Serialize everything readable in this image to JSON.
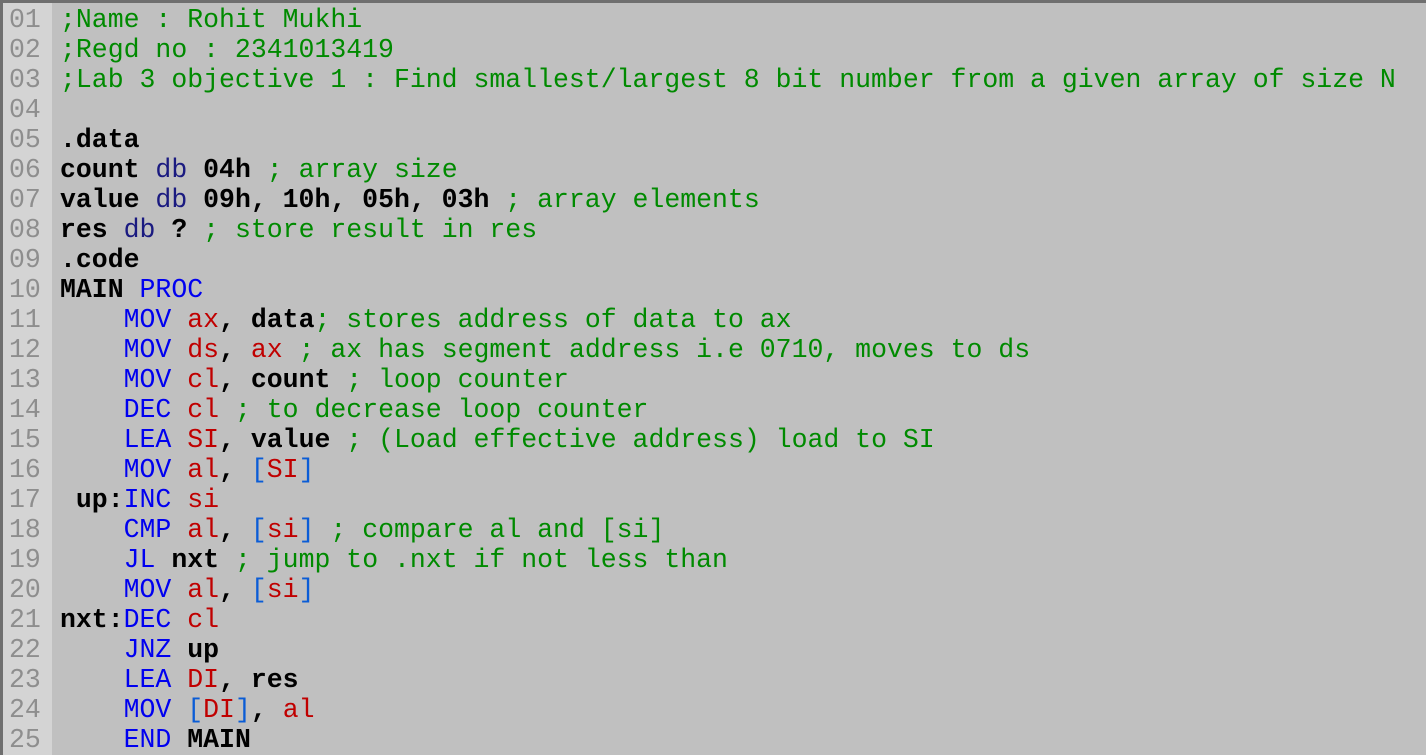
{
  "editor": {
    "lines": [
      {
        "n": "01",
        "tokens": [
          {
            "t": "comment",
            "s": ";Name : Rohit Mukhi"
          }
        ]
      },
      {
        "n": "02",
        "tokens": [
          {
            "t": "comment",
            "s": ";Regd no : 2341013419"
          }
        ]
      },
      {
        "n": "03",
        "tokens": [
          {
            "t": "comment",
            "s": ";Lab 3 objective 1 : Find smallest/largest 8 bit number from a given array of size N"
          }
        ]
      },
      {
        "n": "04",
        "tokens": []
      },
      {
        "n": "05",
        "tokens": [
          {
            "t": "id",
            "s": ".data"
          }
        ]
      },
      {
        "n": "06",
        "tokens": [
          {
            "t": "id",
            "s": "count"
          },
          {
            "t": "plain",
            "s": " "
          },
          {
            "t": "dir",
            "s": "db"
          },
          {
            "t": "plain",
            "s": " "
          },
          {
            "t": "id",
            "s": "04h"
          },
          {
            "t": "plain",
            "s": " "
          },
          {
            "t": "comment",
            "s": "; array size"
          }
        ]
      },
      {
        "n": "07",
        "tokens": [
          {
            "t": "id",
            "s": "value"
          },
          {
            "t": "plain",
            "s": " "
          },
          {
            "t": "dir",
            "s": "db"
          },
          {
            "t": "plain",
            "s": " "
          },
          {
            "t": "id",
            "s": "09h, 10h, 05h, 03h"
          },
          {
            "t": "plain",
            "s": " "
          },
          {
            "t": "comment",
            "s": "; array elements"
          }
        ]
      },
      {
        "n": "08",
        "tokens": [
          {
            "t": "id",
            "s": "res"
          },
          {
            "t": "plain",
            "s": " "
          },
          {
            "t": "dir",
            "s": "db"
          },
          {
            "t": "plain",
            "s": " "
          },
          {
            "t": "id",
            "s": "?"
          },
          {
            "t": "plain",
            "s": " "
          },
          {
            "t": "comment",
            "s": "; store result in res"
          }
        ]
      },
      {
        "n": "09",
        "tokens": [
          {
            "t": "id",
            "s": ".code"
          }
        ]
      },
      {
        "n": "10",
        "tokens": [
          {
            "t": "id",
            "s": "MAIN"
          },
          {
            "t": "plain",
            "s": " "
          },
          {
            "t": "kw",
            "s": "PROC"
          }
        ]
      },
      {
        "n": "11",
        "tokens": [
          {
            "t": "plain",
            "s": "    "
          },
          {
            "t": "kw",
            "s": "MOV"
          },
          {
            "t": "plain",
            "s": " "
          },
          {
            "t": "reg",
            "s": "ax"
          },
          {
            "t": "id",
            "s": ","
          },
          {
            "t": "plain",
            "s": " "
          },
          {
            "t": "id",
            "s": "data"
          },
          {
            "t": "comment",
            "s": "; stores address of data to ax"
          }
        ]
      },
      {
        "n": "12",
        "tokens": [
          {
            "t": "plain",
            "s": "    "
          },
          {
            "t": "kw",
            "s": "MOV"
          },
          {
            "t": "plain",
            "s": " "
          },
          {
            "t": "reg",
            "s": "ds"
          },
          {
            "t": "id",
            "s": ","
          },
          {
            "t": "plain",
            "s": " "
          },
          {
            "t": "reg",
            "s": "ax"
          },
          {
            "t": "plain",
            "s": " "
          },
          {
            "t": "comment",
            "s": "; ax has segment address i.e 0710, moves to ds"
          }
        ]
      },
      {
        "n": "13",
        "tokens": [
          {
            "t": "plain",
            "s": "    "
          },
          {
            "t": "kw",
            "s": "MOV"
          },
          {
            "t": "plain",
            "s": " "
          },
          {
            "t": "reg",
            "s": "cl"
          },
          {
            "t": "id",
            "s": ","
          },
          {
            "t": "plain",
            "s": " "
          },
          {
            "t": "id",
            "s": "count"
          },
          {
            "t": "plain",
            "s": " "
          },
          {
            "t": "comment",
            "s": "; loop counter"
          }
        ]
      },
      {
        "n": "14",
        "tokens": [
          {
            "t": "plain",
            "s": "    "
          },
          {
            "t": "kw",
            "s": "DEC"
          },
          {
            "t": "plain",
            "s": " "
          },
          {
            "t": "reg",
            "s": "cl"
          },
          {
            "t": "plain",
            "s": " "
          },
          {
            "t": "comment",
            "s": "; to decrease loop counter"
          }
        ]
      },
      {
        "n": "15",
        "tokens": [
          {
            "t": "plain",
            "s": "    "
          },
          {
            "t": "kw",
            "s": "LEA"
          },
          {
            "t": "plain",
            "s": " "
          },
          {
            "t": "reg",
            "s": "SI"
          },
          {
            "t": "id",
            "s": ","
          },
          {
            "t": "plain",
            "s": " "
          },
          {
            "t": "id",
            "s": "value"
          },
          {
            "t": "plain",
            "s": " "
          },
          {
            "t": "comment",
            "s": "; (Load effective address) load to SI"
          }
        ]
      },
      {
        "n": "16",
        "tokens": [
          {
            "t": "plain",
            "s": "    "
          },
          {
            "t": "kw",
            "s": "MOV"
          },
          {
            "t": "plain",
            "s": " "
          },
          {
            "t": "reg",
            "s": "al"
          },
          {
            "t": "id",
            "s": ","
          },
          {
            "t": "plain",
            "s": " "
          },
          {
            "t": "br",
            "s": "["
          },
          {
            "t": "reg",
            "s": "SI"
          },
          {
            "t": "br",
            "s": "]"
          }
        ]
      },
      {
        "n": "17",
        "tokens": [
          {
            "t": "plain",
            "s": " "
          },
          {
            "t": "id",
            "s": "up:"
          },
          {
            "t": "kw",
            "s": "INC"
          },
          {
            "t": "plain",
            "s": " "
          },
          {
            "t": "reg",
            "s": "si"
          }
        ]
      },
      {
        "n": "18",
        "tokens": [
          {
            "t": "plain",
            "s": "    "
          },
          {
            "t": "kw",
            "s": "CMP"
          },
          {
            "t": "plain",
            "s": " "
          },
          {
            "t": "reg",
            "s": "al"
          },
          {
            "t": "id",
            "s": ","
          },
          {
            "t": "plain",
            "s": " "
          },
          {
            "t": "br",
            "s": "["
          },
          {
            "t": "reg",
            "s": "si"
          },
          {
            "t": "br",
            "s": "]"
          },
          {
            "t": "plain",
            "s": " "
          },
          {
            "t": "comment",
            "s": "; compare al and [si]"
          }
        ]
      },
      {
        "n": "19",
        "tokens": [
          {
            "t": "plain",
            "s": "    "
          },
          {
            "t": "kw",
            "s": "JL"
          },
          {
            "t": "plain",
            "s": " "
          },
          {
            "t": "id",
            "s": "nxt"
          },
          {
            "t": "plain",
            "s": " "
          },
          {
            "t": "comment",
            "s": "; jump to .nxt if not less than"
          }
        ]
      },
      {
        "n": "20",
        "tokens": [
          {
            "t": "plain",
            "s": "    "
          },
          {
            "t": "kw",
            "s": "MOV"
          },
          {
            "t": "plain",
            "s": " "
          },
          {
            "t": "reg",
            "s": "al"
          },
          {
            "t": "id",
            "s": ","
          },
          {
            "t": "plain",
            "s": " "
          },
          {
            "t": "br",
            "s": "["
          },
          {
            "t": "reg",
            "s": "si"
          },
          {
            "t": "br",
            "s": "]"
          }
        ]
      },
      {
        "n": "21",
        "tokens": [
          {
            "t": "id",
            "s": "nxt:"
          },
          {
            "t": "kw",
            "s": "DEC"
          },
          {
            "t": "plain",
            "s": " "
          },
          {
            "t": "reg",
            "s": "cl"
          }
        ]
      },
      {
        "n": "22",
        "tokens": [
          {
            "t": "plain",
            "s": "    "
          },
          {
            "t": "kw",
            "s": "JNZ"
          },
          {
            "t": "plain",
            "s": " "
          },
          {
            "t": "id",
            "s": "up"
          }
        ]
      },
      {
        "n": "23",
        "tokens": [
          {
            "t": "plain",
            "s": "    "
          },
          {
            "t": "kw",
            "s": "LEA"
          },
          {
            "t": "plain",
            "s": " "
          },
          {
            "t": "reg",
            "s": "DI"
          },
          {
            "t": "id",
            "s": ","
          },
          {
            "t": "plain",
            "s": " "
          },
          {
            "t": "id",
            "s": "res"
          }
        ]
      },
      {
        "n": "24",
        "tokens": [
          {
            "t": "plain",
            "s": "    "
          },
          {
            "t": "kw",
            "s": "MOV"
          },
          {
            "t": "plain",
            "s": " "
          },
          {
            "t": "br",
            "s": "["
          },
          {
            "t": "reg",
            "s": "DI"
          },
          {
            "t": "br",
            "s": "]"
          },
          {
            "t": "id",
            "s": ","
          },
          {
            "t": "plain",
            "s": " "
          },
          {
            "t": "reg",
            "s": "al"
          }
        ]
      },
      {
        "n": "25",
        "tokens": [
          {
            "t": "plain",
            "s": "    "
          },
          {
            "t": "kw",
            "s": "END"
          },
          {
            "t": "plain",
            "s": " "
          },
          {
            "t": "id",
            "s": "MAIN"
          }
        ]
      }
    ]
  },
  "colors": {
    "background": "#c0c0c0",
    "gutter": "#d4d4d4",
    "line_number": "#8e8e8e",
    "comment": "#008a00",
    "keyword": "#0000f0",
    "register": "#c00000",
    "identifier": "#000000",
    "directive": "#1a1a80",
    "bracket": "#0a5cd6"
  }
}
